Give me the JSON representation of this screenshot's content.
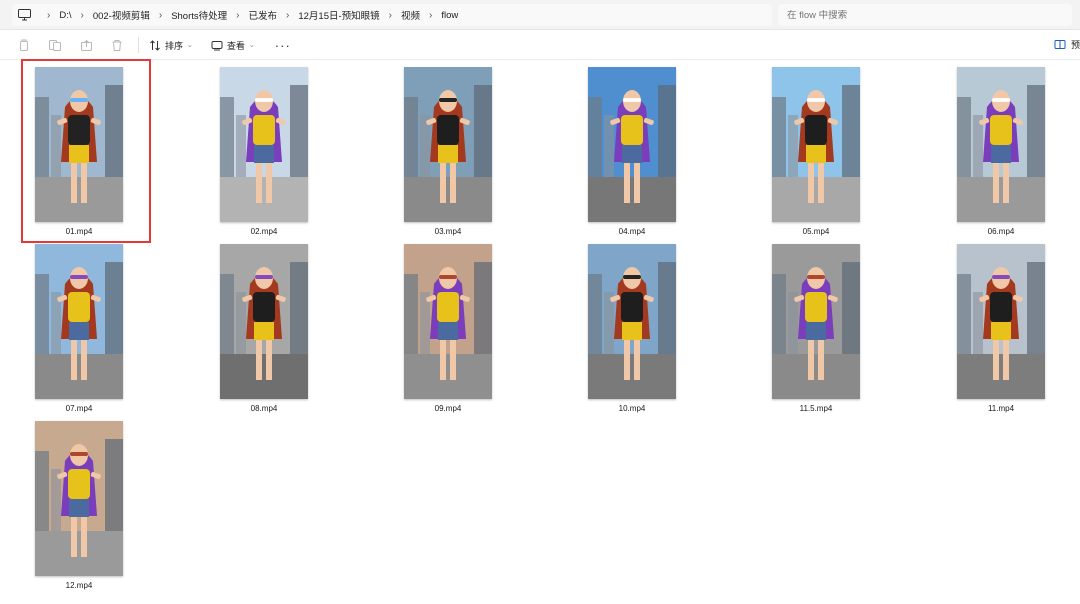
{
  "breadcrumb": [
    "D:\\",
    "002-视频剪辑",
    "Shorts待处理",
    "已发布",
    "12月15日-预知眼镜",
    "视频",
    "flow"
  ],
  "search": {
    "placeholder": "在 flow 中搜索"
  },
  "toolbar": {
    "sort_label": "排序",
    "view_label": "查看",
    "more_label": "···",
    "preview_label": "预"
  },
  "files": [
    {
      "name": "01.mp4",
      "selected": true,
      "sky": "#9fb8cf",
      "hair": "#a33a1f",
      "top": "#222222",
      "bottom": "#e8c21a",
      "ground": "#9a9a9a",
      "accent": "#5ab0ff"
    },
    {
      "name": "02.mp4",
      "selected": false,
      "sky": "#c9d8e6",
      "hair": "#7a3dbb",
      "top": "#e6c21a",
      "bottom": "#4a6aa0",
      "ground": "#b3b3b3",
      "accent": "#ffffff"
    },
    {
      "name": "03.mp4",
      "selected": false,
      "sky": "#7f9fb8",
      "hair": "#a33a1f",
      "top": "#1e1e1e",
      "bottom": "#e8c21a",
      "ground": "#8a8a8a",
      "accent": "#111111"
    },
    {
      "name": "04.mp4",
      "selected": false,
      "sky": "#4f8fd0",
      "hair": "#7a3dbb",
      "top": "#e6c21a",
      "bottom": "#4a6aa0",
      "ground": "#777777",
      "accent": "#ffffff"
    },
    {
      "name": "05.mp4",
      "selected": false,
      "sky": "#8fc4ea",
      "hair": "#a33a1f",
      "top": "#1e1e1e",
      "bottom": "#e8c21a",
      "ground": "#a8a8a8",
      "accent": "#ffffff"
    },
    {
      "name": "06.mp4",
      "selected": false,
      "sky": "#b8c9d6",
      "hair": "#7a3dbb",
      "top": "#e6c21a",
      "bottom": "#4a6aa0",
      "ground": "#9a9a9a",
      "accent": "#ffffff"
    },
    {
      "name": "07.mp4",
      "selected": false,
      "sky": "#8fb8dc",
      "hair": "#a33a1f",
      "top": "#e6c21a",
      "bottom": "#4a6aa0",
      "ground": "#8a8a8a",
      "accent": "#7a3dbb"
    },
    {
      "name": "08.mp4",
      "selected": false,
      "sky": "#a7a7a7",
      "hair": "#a33a1f",
      "top": "#1e1e1e",
      "bottom": "#e8c21a",
      "ground": "#6f6f6f",
      "accent": "#7a3dbb"
    },
    {
      "name": "09.mp4",
      "selected": false,
      "sky": "#c2a28a",
      "hair": "#7a3dbb",
      "top": "#e6c21a",
      "bottom": "#4a6aa0",
      "ground": "#8f8f8f",
      "accent": "#a33a1f"
    },
    {
      "name": "10.mp4",
      "selected": false,
      "sky": "#7fa6c9",
      "hair": "#a33a1f",
      "top": "#1e1e1e",
      "bottom": "#e8c21a",
      "ground": "#7a7a7a",
      "accent": "#111111"
    },
    {
      "name": "11.5.mp4",
      "selected": false,
      "sky": "#9a9a9a",
      "hair": "#7a3dbb",
      "top": "#e6c21a",
      "bottom": "#4a6aa0",
      "ground": "#8a8a8a",
      "accent": "#a33a1f"
    },
    {
      "name": "11.mp4",
      "selected": false,
      "sky": "#b8c2cc",
      "hair": "#a33a1f",
      "top": "#1e1e1e",
      "bottom": "#e8c21a",
      "ground": "#7d7d7d",
      "accent": "#7a3dbb"
    },
    {
      "name": "12.mp4",
      "selected": false,
      "sky": "#c6a98f",
      "hair": "#7a3dbb",
      "top": "#e6c21a",
      "bottom": "#4a6aa0",
      "ground": "#9a9a9a",
      "accent": "#a33a1f"
    }
  ]
}
